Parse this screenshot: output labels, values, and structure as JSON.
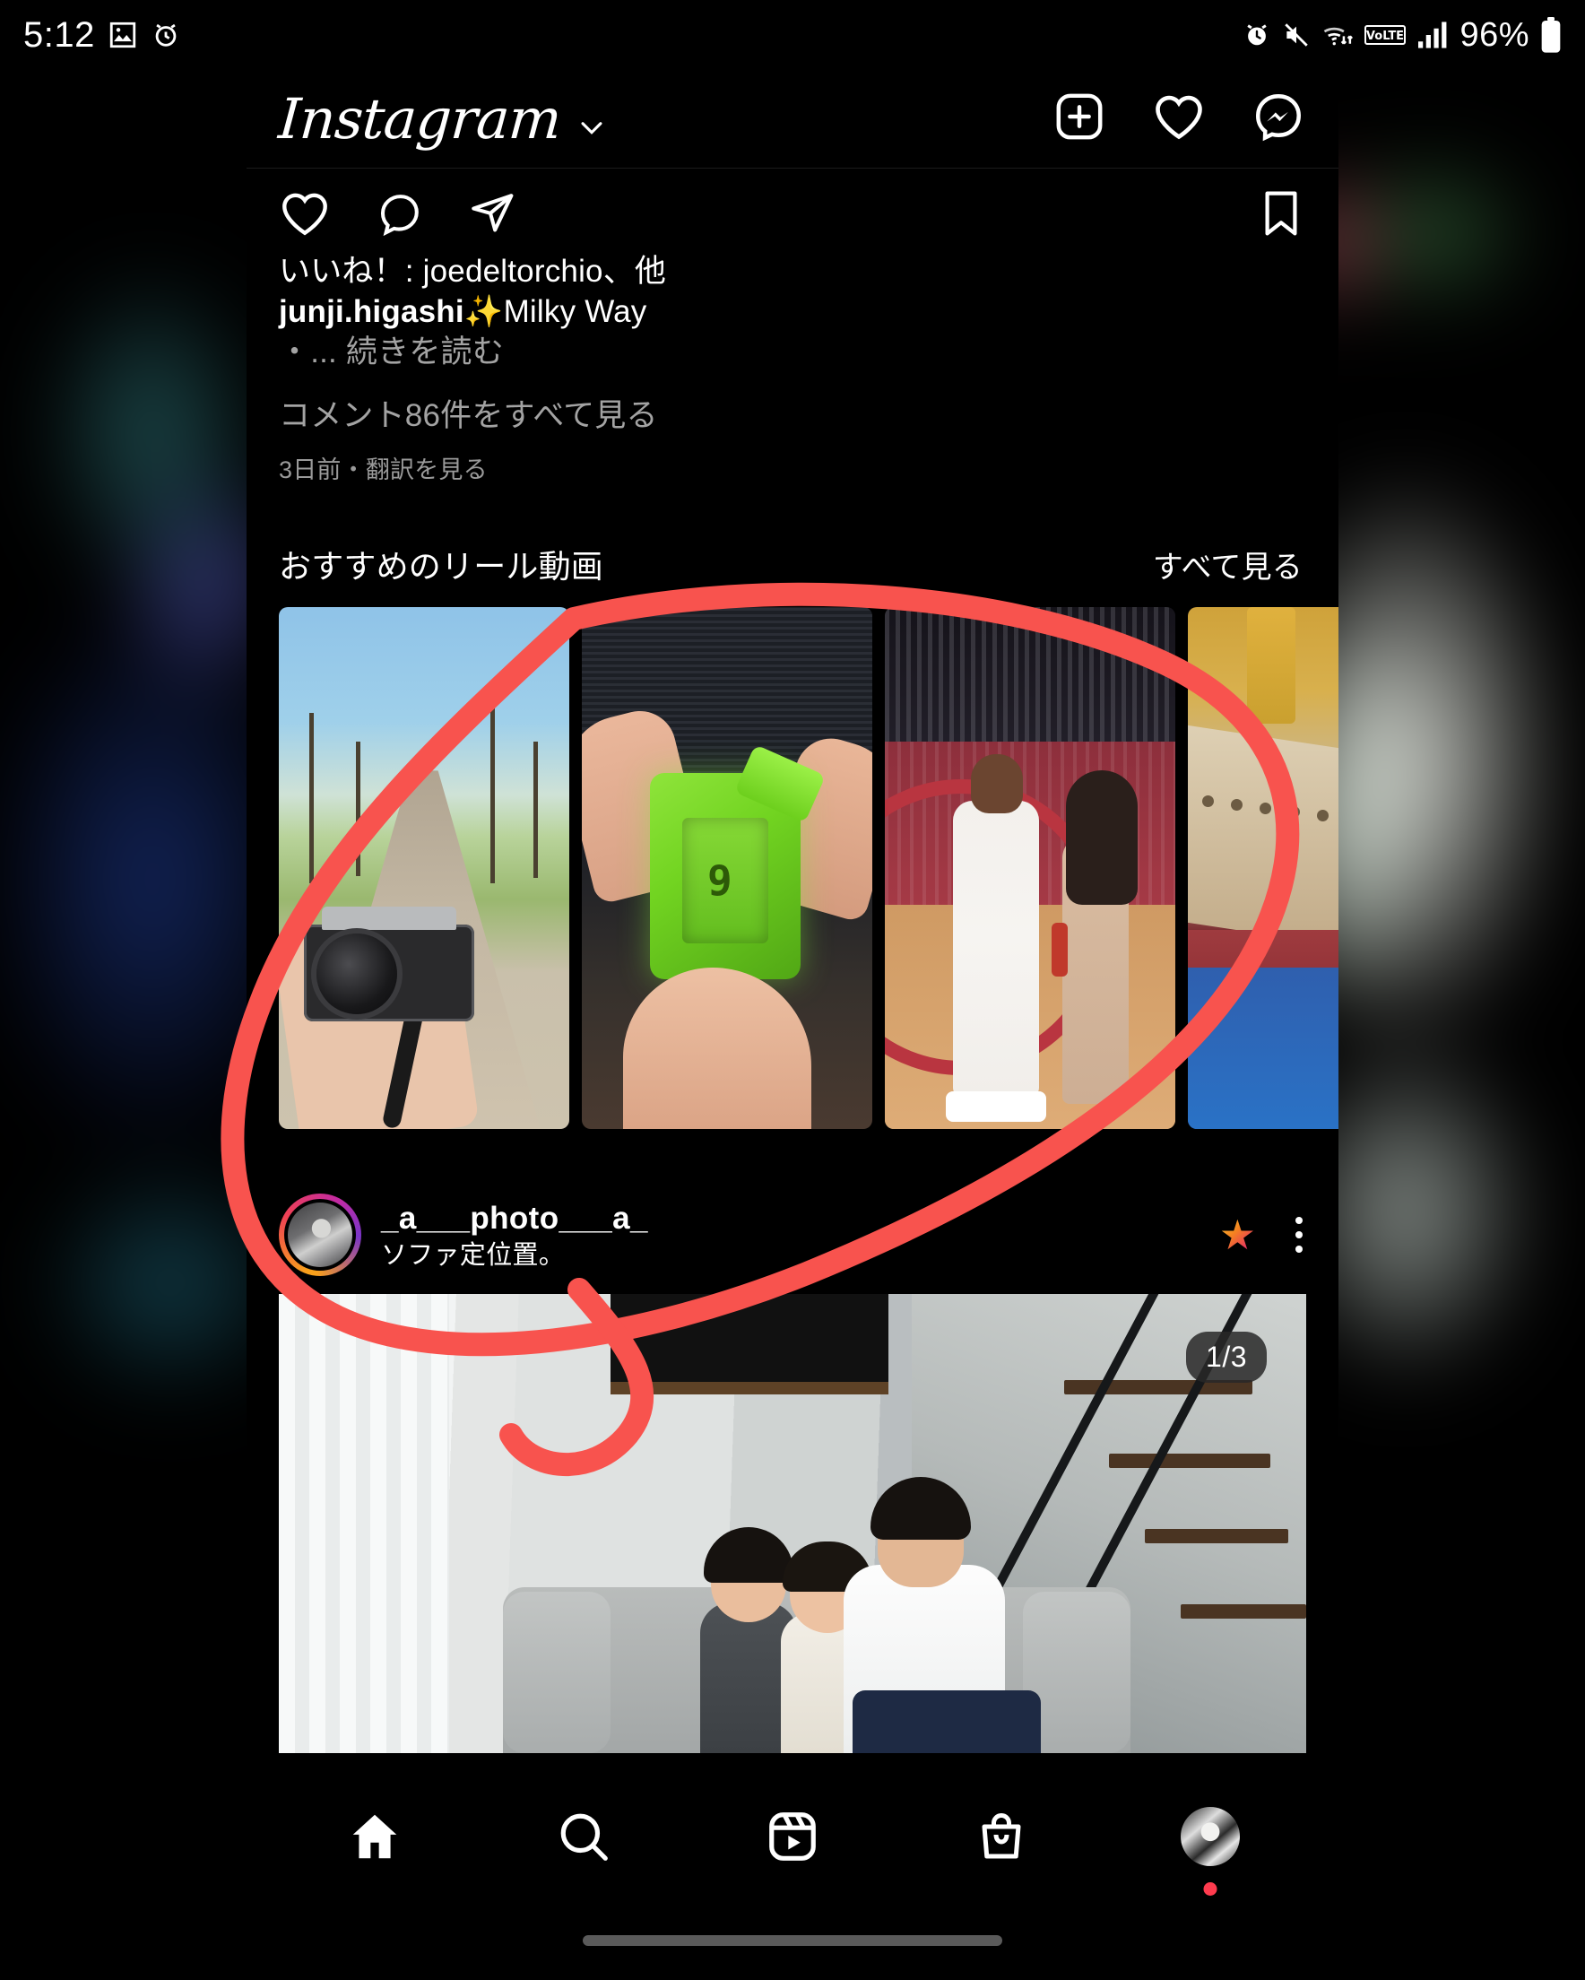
{
  "status_bar": {
    "time": "5:12",
    "battery_percent": "96%",
    "left_icons": [
      "image-icon",
      "alarm-clock-icon"
    ],
    "right_icons": [
      "alarm-icon",
      "mute-icon",
      "wifi-icon",
      "volte-icon",
      "signal-bars-icon",
      "battery-icon"
    ]
  },
  "header": {
    "logo_text": "Instagram",
    "dropdown_icon": "chevron-down-icon",
    "icons": [
      "new-post-icon",
      "activity-heart-icon",
      "messenger-icon"
    ]
  },
  "feed_post_top": {
    "actions": [
      "like-heart-icon",
      "comment-icon",
      "share-icon"
    ],
    "save_icon": "bookmark-icon",
    "likes_line": "いいね！: joedeltorchio、他",
    "caption_user": "junji.higashi",
    "caption_sparkle": "✨",
    "caption_text": "Milky Way",
    "caption_more_prefix": "・...",
    "caption_more": "続きを読む",
    "comments_link": "コメント86件をすべて見る",
    "meta": "3日前・翻訳を見る"
  },
  "reels_section": {
    "title": "おすすめのリール動画",
    "see_all": "すべて見る",
    "see_all_icon": "play-triangle-icon",
    "thumbnails": [
      {
        "name": "reel-camera-road",
        "alt": "hand holding film camera on tree-lined road"
      },
      {
        "name": "reel-green-gadget",
        "alt": "hands holding green translucent gadget"
      },
      {
        "name": "reel-basketball-interview",
        "alt": "basketball player interviewed courtside"
      },
      {
        "name": "reel-lego-ship",
        "alt": "lego ocean liner model"
      }
    ]
  },
  "post": {
    "username": "_a___photo___a_",
    "subtitle": "ソファ定位置。",
    "star_icon": "favorite-star-icon",
    "more_icon": "more-options-icon",
    "pager": "1/3",
    "photo_alt": "father with two children on grey sofa beside staircase"
  },
  "bottom_nav": {
    "items": [
      {
        "name": "nav-home",
        "icon": "home-icon",
        "active": true
      },
      {
        "name": "nav-search",
        "icon": "search-icon",
        "active": false
      },
      {
        "name": "nav-reels",
        "icon": "reels-icon",
        "active": false
      },
      {
        "name": "nav-shop",
        "icon": "shop-bag-icon",
        "active": false
      },
      {
        "name": "nav-profile",
        "icon": "profile-avatar-icon",
        "active": false
      }
    ]
  },
  "annotation": {
    "color": "#f8534e",
    "shape": "hand-drawn-circle-with-tail",
    "description": "red freehand ellipse drawn around the suggested reels carousel"
  },
  "colors": {
    "background": "#000000",
    "text_primary": "#ffffff",
    "text_muted": "#a3a3a3",
    "annotation_red": "#f8534e",
    "notification_red": "#ff3b4e"
  }
}
